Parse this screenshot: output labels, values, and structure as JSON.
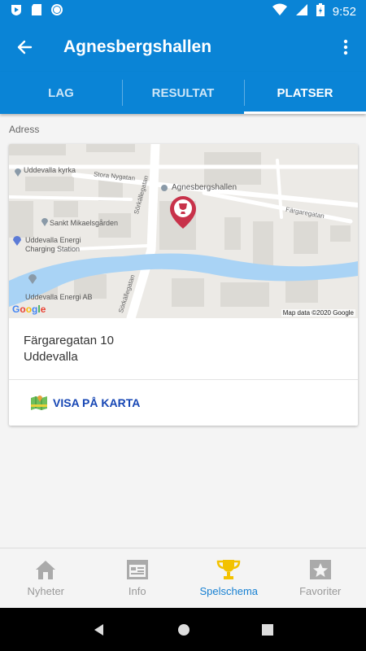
{
  "status_bar": {
    "time": "9:52"
  },
  "app_bar": {
    "title": "Agnesbergshallen"
  },
  "tabs": [
    {
      "label": "LAG",
      "active": false
    },
    {
      "label": "RESULTAT",
      "active": false
    },
    {
      "label": "PLATSER",
      "active": true
    }
  ],
  "section": {
    "label": "Adress"
  },
  "map": {
    "labels": {
      "kyrka": "Uddevalla kyrka",
      "nygatan": "Stora Nygatan",
      "hallen": "Agnesbergshallen",
      "fargaregatan": "Färgaregatan",
      "mikael": "Sankt Mikaelsgården",
      "energi_charging_1": "Uddevalla Energi",
      "energi_charging_2": "Charging Station",
      "energi_ab": "Uddevalla Energi AB",
      "sorkallegatan_top": "Sörkällegatan",
      "sorkallegatan_bottom": "Sörkällegatan"
    },
    "logo": "Google",
    "copyright": "Map data ©2020 Google"
  },
  "address": {
    "line1": "Färgaregatan 10",
    "line2": "Uddevalla"
  },
  "action": {
    "label": "VISA PÅ KARTA"
  },
  "bottom_nav": [
    {
      "label": "Nyheter",
      "icon": "house-icon",
      "active": false
    },
    {
      "label": "Info",
      "icon": "browser-icon",
      "active": false
    },
    {
      "label": "Spelschema",
      "icon": "trophy-icon",
      "active": true
    },
    {
      "label": "Favoriter",
      "icon": "star-icon",
      "active": false
    }
  ],
  "colors": {
    "primary": "#0a84d6",
    "accent_nav": "#1780d2",
    "link": "#1646b4",
    "pin": "#c8324a",
    "river": "#a9d3f5"
  }
}
